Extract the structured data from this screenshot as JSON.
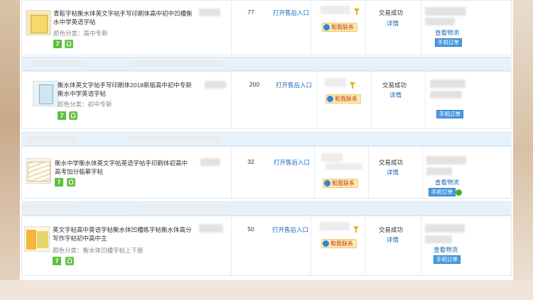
{
  "orders": [
    {
      "title": "青鬆字帖衡水体英文字帖手写印刷体高中初中凹槽衡水中学英语字帖",
      "color_label": "颜色分类：",
      "color_value": "高中专新",
      "quantity": "77",
      "after_sale": "打开售后入口",
      "contact": "和我联系",
      "status": "交易成功",
      "detail": "详情",
      "logistics": "查看物流",
      "mobile_order": "手机订单"
    },
    {
      "title": "衡水体英文字帖手写印刷体2018新版高中初中专新衡水中学英语字帖",
      "color_label": "颜色分类：",
      "color_value": "初中专新",
      "quantity": "200",
      "after_sale": "打开售后入口",
      "contact": "和我联系",
      "status": "交易成功",
      "detail": "详情",
      "logistics": "",
      "mobile_order": "手机订单"
    },
    {
      "title": "衡水中学衡水体英文字帖英语字帖手印刷体初高中高考加分临摹字帖",
      "color_label": "",
      "color_value": "",
      "quantity": "32",
      "after_sale": "打开售后入口",
      "contact": "和我联系",
      "status": "交易成功",
      "detail": "详情",
      "logistics": "查看物流",
      "mobile_order": "手机订单"
    },
    {
      "title": "英文字帖高中英语字帖衡水体凹槽练字帖衡水体高分写作字帖初中高中主",
      "color_label": "颜色分类：",
      "color_value": "衡水体凹槽字帖上下册",
      "quantity": "50",
      "after_sale": "打开售后入口",
      "contact": "和我联系",
      "status": "交易成功",
      "detail": "详情",
      "logistics": "查看物流",
      "mobile_order": "手机订单"
    }
  ],
  "icons": {
    "tmall_seven": "7",
    "shield": "shield-icon",
    "filter": "funnel-icon",
    "chat": "qq-chat-icon"
  },
  "colors": {
    "link": "#1b66b6",
    "contact_bg": "#fde9b1",
    "mobile_badge": "#4c9be0",
    "separator": "#e6f2fb"
  }
}
